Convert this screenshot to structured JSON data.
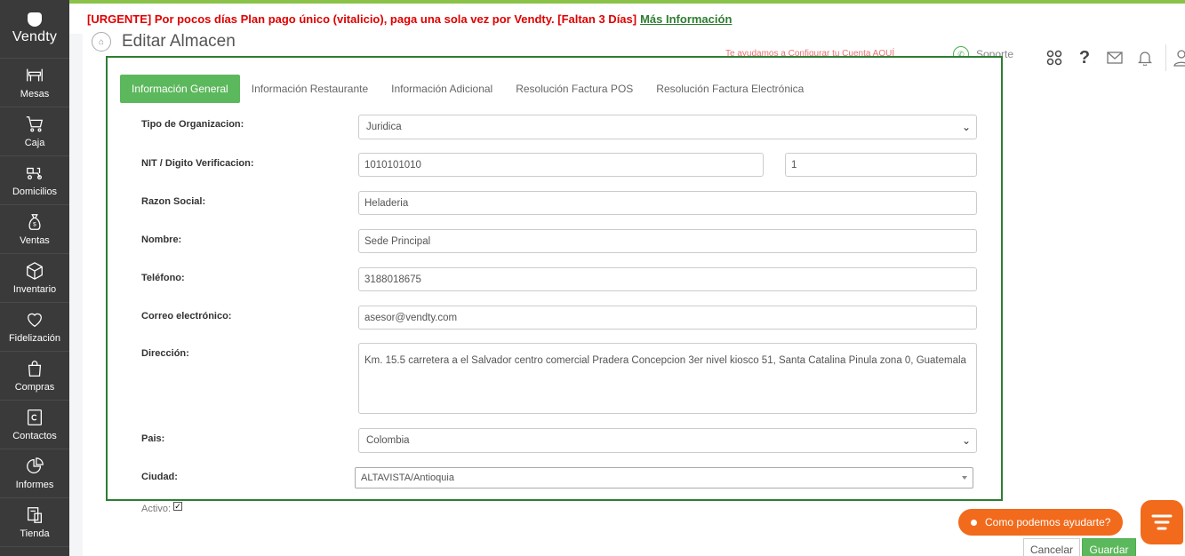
{
  "app": {
    "logo_text": "Vendty"
  },
  "sidebar": {
    "items": [
      {
        "label": "Mesas",
        "icon": "tables-icon"
      },
      {
        "label": "Caja",
        "icon": "cart-icon"
      },
      {
        "label": "Domicilios",
        "icon": "scooter-icon"
      },
      {
        "label": "Ventas",
        "icon": "money-bag-icon"
      },
      {
        "label": "Inventario",
        "icon": "box-icon"
      },
      {
        "label": "Fidelización",
        "icon": "heart-icon"
      },
      {
        "label": "Compras",
        "icon": "shopping-bag-icon"
      },
      {
        "label": "Contactos",
        "icon": "contacts-icon"
      },
      {
        "label": "Informes",
        "icon": "pie-chart-icon"
      },
      {
        "label": "Tienda",
        "icon": "store-icon"
      }
    ]
  },
  "banner": {
    "text": "[URGENTE] Por pocos días Plan pago único (vitalicio), paga una sola vez por Vendty. [Faltan 3 Días]",
    "link": "Más Información",
    "text_color": "#e00000",
    "link_color": "#2e7d32"
  },
  "header": {
    "title": "Editar Almacen",
    "help_link": "Te ayudamos a Configurar tu Cuenta AQUÍ",
    "support_label": "Soporte",
    "help_icon_glyph": "?"
  },
  "tabs": [
    {
      "label": "Información General",
      "active": true
    },
    {
      "label": "Información Restaurante",
      "active": false
    },
    {
      "label": "Información Adicional",
      "active": false
    },
    {
      "label": "Resolución Factura POS",
      "active": false
    },
    {
      "label": "Resolución Factura Electrónica",
      "active": false
    }
  ],
  "form": {
    "tipo_org": {
      "label": "Tipo de Organizacion:",
      "value": "Juridica"
    },
    "nit": {
      "label": "NIT / Digito Verificacion:",
      "value": "1010101010",
      "digit": "1"
    },
    "razon_social": {
      "label": "Razon Social:",
      "value": "Heladeria"
    },
    "nombre": {
      "label": "Nombre:",
      "value": "Sede Principal"
    },
    "telefono": {
      "label": "Teléfono:",
      "value": "3188018675"
    },
    "correo": {
      "label": "Correo electrónico:",
      "value": "asesor@vendty.com"
    },
    "direccion": {
      "label": "Dirección:",
      "value": "Km. 15.5 carretera a el Salvador centro comercial Pradera Concepcion 3er nivel kiosco 51, Santa Catalina Pinula zona 0, Guatemala"
    },
    "pais": {
      "label": "Pais:",
      "value": "Colombia"
    },
    "ciudad": {
      "label": "Ciudad:",
      "value": "ALTAVISTA/Antioquia"
    },
    "activo": {
      "label": "Activo:",
      "checked": true
    }
  },
  "chat": {
    "label": "Como podemos ayudarte?",
    "color": "#f26a1b"
  },
  "buttons": {
    "cancel": "Cancelar",
    "save": "Guardar"
  },
  "colors": {
    "accent": "#5cb85c",
    "form_border": "#2e7d32",
    "sidebar_bg": "#3a3a3a"
  }
}
